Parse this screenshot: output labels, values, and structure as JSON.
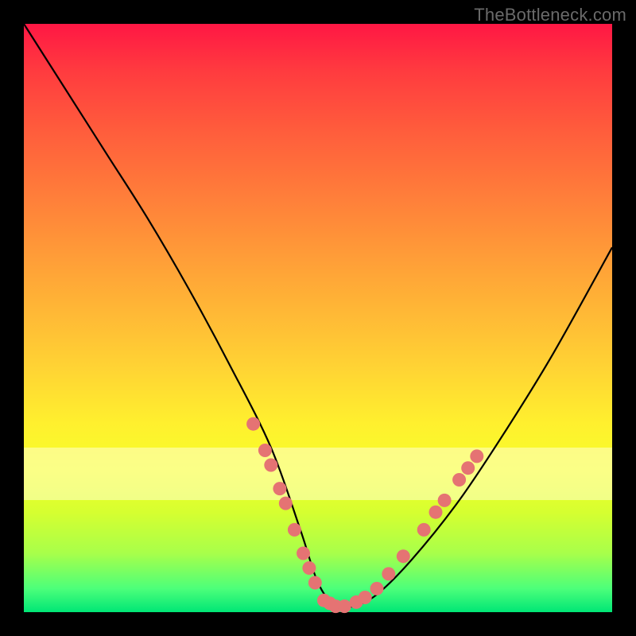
{
  "watermark": "TheBottleneck.com",
  "colors": {
    "frame": "#000000",
    "gradient_top": "#ff1744",
    "gradient_bottom": "#00e676",
    "band": "rgba(255,255,210,0.55)",
    "curve": "#000000",
    "dot": "#e57373"
  },
  "chart_data": {
    "type": "line",
    "title": "",
    "xlabel": "",
    "ylabel": "",
    "xlim": [
      0,
      100
    ],
    "ylim": [
      0,
      100
    ],
    "band": {
      "y_min": 19,
      "y_max": 28
    },
    "series": [
      {
        "name": "bottleneck-curve",
        "x": [
          0,
          7,
          14,
          21,
          28,
          35,
          42,
          47,
          50,
          53,
          56,
          60,
          66,
          74,
          82,
          90,
          100
        ],
        "values": [
          100,
          89,
          78,
          67,
          55,
          42,
          28,
          14,
          5,
          1,
          1,
          3,
          9,
          19,
          31,
          44,
          62
        ]
      }
    ],
    "markers": {
      "name": "highlight-dots",
      "points": [
        {
          "x": 39.0,
          "y": 32.0
        },
        {
          "x": 41.0,
          "y": 27.5
        },
        {
          "x": 42.0,
          "y": 25.0
        },
        {
          "x": 43.5,
          "y": 21.0
        },
        {
          "x": 44.5,
          "y": 18.5
        },
        {
          "x": 46.0,
          "y": 14.0
        },
        {
          "x": 47.5,
          "y": 10.0
        },
        {
          "x": 48.5,
          "y": 7.5
        },
        {
          "x": 49.5,
          "y": 5.0
        },
        {
          "x": 51.0,
          "y": 2.0
        },
        {
          "x": 52.0,
          "y": 1.5
        },
        {
          "x": 53.0,
          "y": 1.0
        },
        {
          "x": 54.5,
          "y": 1.0
        },
        {
          "x": 56.5,
          "y": 1.7
        },
        {
          "x": 58.0,
          "y": 2.5
        },
        {
          "x": 60.0,
          "y": 4.0
        },
        {
          "x": 62.0,
          "y": 6.5
        },
        {
          "x": 64.5,
          "y": 9.5
        },
        {
          "x": 68.0,
          "y": 14.0
        },
        {
          "x": 70.0,
          "y": 17.0
        },
        {
          "x": 71.5,
          "y": 19.0
        },
        {
          "x": 74.0,
          "y": 22.5
        },
        {
          "x": 75.5,
          "y": 24.5
        },
        {
          "x": 77.0,
          "y": 26.5
        }
      ]
    }
  }
}
